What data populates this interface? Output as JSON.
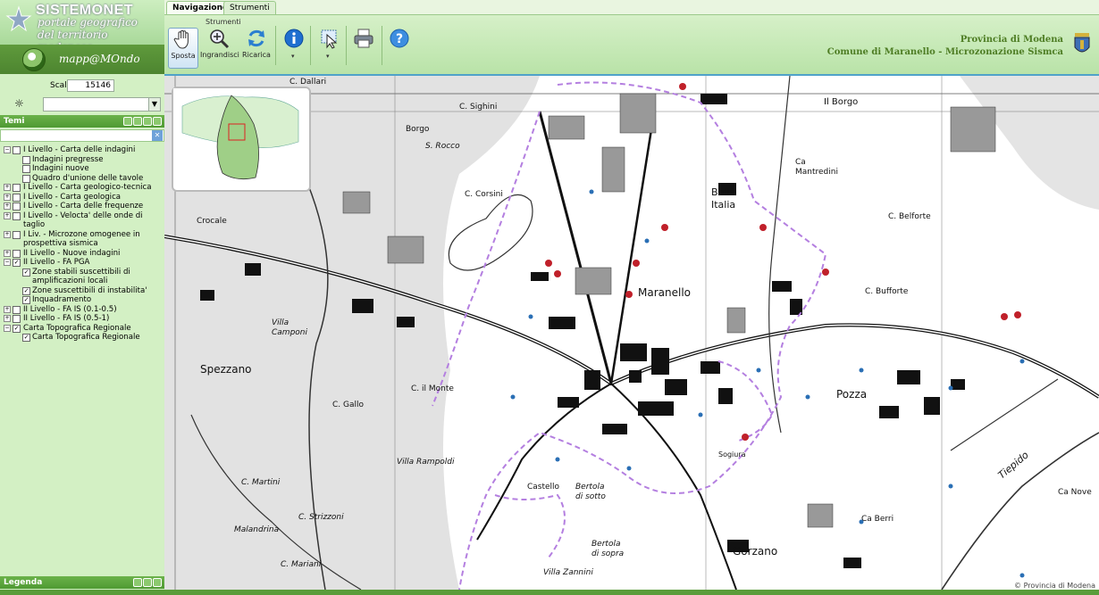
{
  "header": {
    "logo_title": "SISTEMONET",
    "logo_sub1": "portale geografico",
    "logo_sub2": "del territorio modenese",
    "mappa_label": "mapp@MOndo"
  },
  "tabs": [
    {
      "label": "Navigazione"
    },
    {
      "label": "Strumenti"
    }
  ],
  "toolbar": {
    "caption": "Strumenti",
    "sposta": "Sposta",
    "ingrandisci": "Ingrandisci",
    "ricarica": "Ricarica",
    "provincia": "Provincia di Modena",
    "comune": "Comune di Maranello - Microzonazione Sismca"
  },
  "scale": {
    "label": "Scala",
    "value": "15146"
  },
  "panel": {
    "temi_title": "Temi",
    "legenda_title": "Legenda"
  },
  "layers": [
    {
      "label": "I Livello - Carta delle indagini",
      "level": 0,
      "expanded": true,
      "checked": false
    },
    {
      "label": "Indagini pregresse",
      "level": 1,
      "checked": false
    },
    {
      "label": "Indagini nuove",
      "level": 1,
      "checked": false
    },
    {
      "label": "Quadro d'unione delle tavole",
      "level": 1,
      "checked": false
    },
    {
      "label": "I Livello - Carta geologico-tecnica",
      "level": 0,
      "expanded": false,
      "checked": false
    },
    {
      "label": "I Livello - Carta geologica",
      "level": 0,
      "expanded": false,
      "checked": false
    },
    {
      "label": "I Livello - Carta delle frequenze",
      "level": 0,
      "expanded": false,
      "checked": false
    },
    {
      "label": "I Livello - Velocta' delle onde di taglio",
      "level": 0,
      "expanded": false,
      "checked": false
    },
    {
      "label": "I Liv. - Microzone omogenee in prospettiva sismica",
      "level": 0,
      "expanded": false,
      "checked": false
    },
    {
      "label": "II Livello - Nuove indagini",
      "level": 0,
      "expanded": false,
      "checked": false
    },
    {
      "label": "II Livello - FA PGA",
      "level": 0,
      "expanded": true,
      "checked": true
    },
    {
      "label": "Zone stabili suscettibili di amplificazioni locali",
      "level": 1,
      "checked": true
    },
    {
      "label": "Zone suscettibili di instabilita'",
      "level": 1,
      "checked": true
    },
    {
      "label": "Inquadramento",
      "level": 1,
      "checked": true
    },
    {
      "label": "II Livello - FA IS (0.1-0.5)",
      "level": 0,
      "expanded": false,
      "checked": false
    },
    {
      "label": "II Livello - FA IS (0.5-1)",
      "level": 0,
      "expanded": false,
      "checked": false
    },
    {
      "label": "Carta Topografica Regionale",
      "level": 0,
      "expanded": true,
      "checked": true
    },
    {
      "label": "Carta Topografica Regionale",
      "level": 1,
      "checked": true
    }
  ],
  "map": {
    "places": [
      {
        "name": "C. Dallari"
      },
      {
        "name": "C. Sighini"
      },
      {
        "name": "Borgo"
      },
      {
        "name": "S. Rocco"
      },
      {
        "name": "Il Borgo"
      },
      {
        "name": "Bella Italia"
      },
      {
        "name": "Ca Mantredini"
      },
      {
        "name": "C. Belforte"
      },
      {
        "name": "C. Bufforte"
      },
      {
        "name": "C. Corsini"
      },
      {
        "name": "Crocale"
      },
      {
        "name": "Maranello"
      },
      {
        "name": "Villa Camponi"
      },
      {
        "name": "Spezzano"
      },
      {
        "name": "C. Gallo"
      },
      {
        "name": "C. il Monte"
      },
      {
        "name": "Pozza"
      },
      {
        "name": "Villa Rampoldi"
      },
      {
        "name": "C. Martini"
      },
      {
        "name": "Castello"
      },
      {
        "name": "Bertola di sotto"
      },
      {
        "name": "C. Strizzoni"
      },
      {
        "name": "Malandrina"
      },
      {
        "name": "C. Mariani"
      },
      {
        "name": "Villa Zannini"
      },
      {
        "name": "Bertola di sopra"
      },
      {
        "name": "Gorzano"
      },
      {
        "name": "Ca Berri"
      },
      {
        "name": "Tiepido"
      },
      {
        "name": "Sogiura"
      },
      {
        "name": "Ca Nove"
      }
    ],
    "copyright": "© Provincia di Modena",
    "colors": {
      "zone_boundary": "#b47fe0",
      "survey_point": "#c0202a",
      "survey_marker": "#2a6fb5"
    }
  }
}
